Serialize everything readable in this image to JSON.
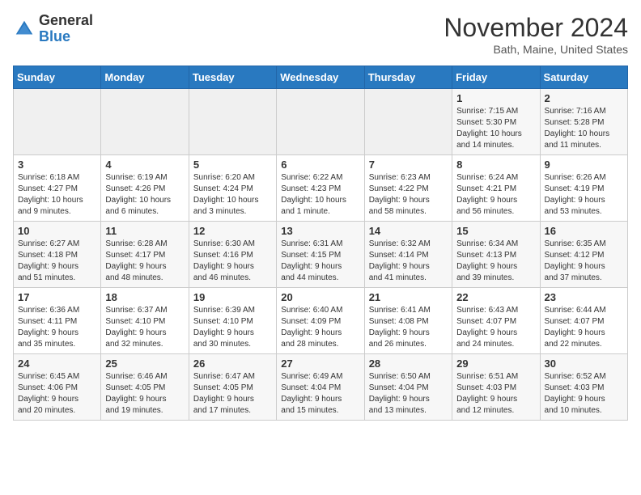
{
  "header": {
    "logo_line1": "General",
    "logo_line2": "Blue",
    "month": "November 2024",
    "location": "Bath, Maine, United States"
  },
  "weekdays": [
    "Sunday",
    "Monday",
    "Tuesday",
    "Wednesday",
    "Thursday",
    "Friday",
    "Saturday"
  ],
  "weeks": [
    [
      {
        "day": "",
        "info": ""
      },
      {
        "day": "",
        "info": ""
      },
      {
        "day": "",
        "info": ""
      },
      {
        "day": "",
        "info": ""
      },
      {
        "day": "",
        "info": ""
      },
      {
        "day": "1",
        "info": "Sunrise: 7:15 AM\nSunset: 5:30 PM\nDaylight: 10 hours\nand 14 minutes."
      },
      {
        "day": "2",
        "info": "Sunrise: 7:16 AM\nSunset: 5:28 PM\nDaylight: 10 hours\nand 11 minutes."
      }
    ],
    [
      {
        "day": "3",
        "info": "Sunrise: 6:18 AM\nSunset: 4:27 PM\nDaylight: 10 hours\nand 9 minutes."
      },
      {
        "day": "4",
        "info": "Sunrise: 6:19 AM\nSunset: 4:26 PM\nDaylight: 10 hours\nand 6 minutes."
      },
      {
        "day": "5",
        "info": "Sunrise: 6:20 AM\nSunset: 4:24 PM\nDaylight: 10 hours\nand 3 minutes."
      },
      {
        "day": "6",
        "info": "Sunrise: 6:22 AM\nSunset: 4:23 PM\nDaylight: 10 hours\nand 1 minute."
      },
      {
        "day": "7",
        "info": "Sunrise: 6:23 AM\nSunset: 4:22 PM\nDaylight: 9 hours\nand 58 minutes."
      },
      {
        "day": "8",
        "info": "Sunrise: 6:24 AM\nSunset: 4:21 PM\nDaylight: 9 hours\nand 56 minutes."
      },
      {
        "day": "9",
        "info": "Sunrise: 6:26 AM\nSunset: 4:19 PM\nDaylight: 9 hours\nand 53 minutes."
      }
    ],
    [
      {
        "day": "10",
        "info": "Sunrise: 6:27 AM\nSunset: 4:18 PM\nDaylight: 9 hours\nand 51 minutes."
      },
      {
        "day": "11",
        "info": "Sunrise: 6:28 AM\nSunset: 4:17 PM\nDaylight: 9 hours\nand 48 minutes."
      },
      {
        "day": "12",
        "info": "Sunrise: 6:30 AM\nSunset: 4:16 PM\nDaylight: 9 hours\nand 46 minutes."
      },
      {
        "day": "13",
        "info": "Sunrise: 6:31 AM\nSunset: 4:15 PM\nDaylight: 9 hours\nand 44 minutes."
      },
      {
        "day": "14",
        "info": "Sunrise: 6:32 AM\nSunset: 4:14 PM\nDaylight: 9 hours\nand 41 minutes."
      },
      {
        "day": "15",
        "info": "Sunrise: 6:34 AM\nSunset: 4:13 PM\nDaylight: 9 hours\nand 39 minutes."
      },
      {
        "day": "16",
        "info": "Sunrise: 6:35 AM\nSunset: 4:12 PM\nDaylight: 9 hours\nand 37 minutes."
      }
    ],
    [
      {
        "day": "17",
        "info": "Sunrise: 6:36 AM\nSunset: 4:11 PM\nDaylight: 9 hours\nand 35 minutes."
      },
      {
        "day": "18",
        "info": "Sunrise: 6:37 AM\nSunset: 4:10 PM\nDaylight: 9 hours\nand 32 minutes."
      },
      {
        "day": "19",
        "info": "Sunrise: 6:39 AM\nSunset: 4:10 PM\nDaylight: 9 hours\nand 30 minutes."
      },
      {
        "day": "20",
        "info": "Sunrise: 6:40 AM\nSunset: 4:09 PM\nDaylight: 9 hours\nand 28 minutes."
      },
      {
        "day": "21",
        "info": "Sunrise: 6:41 AM\nSunset: 4:08 PM\nDaylight: 9 hours\nand 26 minutes."
      },
      {
        "day": "22",
        "info": "Sunrise: 6:43 AM\nSunset: 4:07 PM\nDaylight: 9 hours\nand 24 minutes."
      },
      {
        "day": "23",
        "info": "Sunrise: 6:44 AM\nSunset: 4:07 PM\nDaylight: 9 hours\nand 22 minutes."
      }
    ],
    [
      {
        "day": "24",
        "info": "Sunrise: 6:45 AM\nSunset: 4:06 PM\nDaylight: 9 hours\nand 20 minutes."
      },
      {
        "day": "25",
        "info": "Sunrise: 6:46 AM\nSunset: 4:05 PM\nDaylight: 9 hours\nand 19 minutes."
      },
      {
        "day": "26",
        "info": "Sunrise: 6:47 AM\nSunset: 4:05 PM\nDaylight: 9 hours\nand 17 minutes."
      },
      {
        "day": "27",
        "info": "Sunrise: 6:49 AM\nSunset: 4:04 PM\nDaylight: 9 hours\nand 15 minutes."
      },
      {
        "day": "28",
        "info": "Sunrise: 6:50 AM\nSunset: 4:04 PM\nDaylight: 9 hours\nand 13 minutes."
      },
      {
        "day": "29",
        "info": "Sunrise: 6:51 AM\nSunset: 4:03 PM\nDaylight: 9 hours\nand 12 minutes."
      },
      {
        "day": "30",
        "info": "Sunrise: 6:52 AM\nSunset: 4:03 PM\nDaylight: 9 hours\nand 10 minutes."
      }
    ]
  ]
}
